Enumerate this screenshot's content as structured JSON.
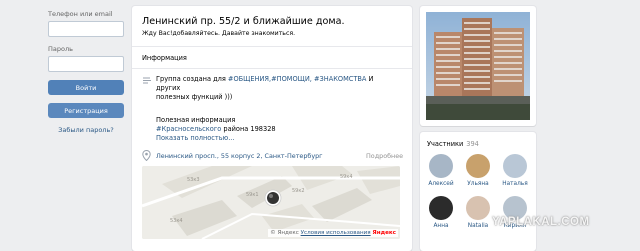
{
  "login": {
    "phone_label": "Телефон или email",
    "phone_value": "",
    "password_label": "Пароль",
    "password_value": "",
    "login_button": "Войти",
    "register_button": "Регистрация",
    "forgot_link": "Забыли пароль?"
  },
  "group": {
    "title": "Ленинский пр. 55/2 и ближайшие дома.",
    "status": "Жду Вас!добавляйтесь. Давайте знакомиться."
  },
  "info": {
    "heading": "Информация",
    "desc_prefix": "Группа создана для ",
    "desc_tags": "#ОБЩЕНИЯ,#ПОМОЩИ, #ЗНАКОМСТВА",
    "desc_suffix": " И других",
    "desc_line2": "полезных функций )))",
    "useful_line1": "Полезная информация",
    "useful_tag": "#Красносельского",
    "useful_rest": " района 198328",
    "more_link": "Показать полностью...",
    "address": "Ленинский просп., 55 корпус 2, Санкт-Петербург",
    "weekend": "Подробнее"
  },
  "map": {
    "copyright": "© Яндекс",
    "terms": "Условия использования",
    "yandex": "Яндекс",
    "house_labels": [
      "59к4",
      "59к1",
      "53к3",
      "59к2",
      "53к4"
    ]
  },
  "members": {
    "title": "Участники",
    "count": "394",
    "people": [
      {
        "name": "Алексей",
        "color": "#a7b6c6"
      },
      {
        "name": "Ульяна",
        "color": "#c8a16c"
      },
      {
        "name": "Наталья",
        "color": "#b9c7d6"
      },
      {
        "name": "Анна",
        "color": "#2b2b2b"
      },
      {
        "name": "Natalia",
        "color": "#d8c2b0"
      },
      {
        "name": "Кирилл",
        "color": "#b7c3cf"
      }
    ]
  },
  "watermark": "YAPLAKAL.COM"
}
